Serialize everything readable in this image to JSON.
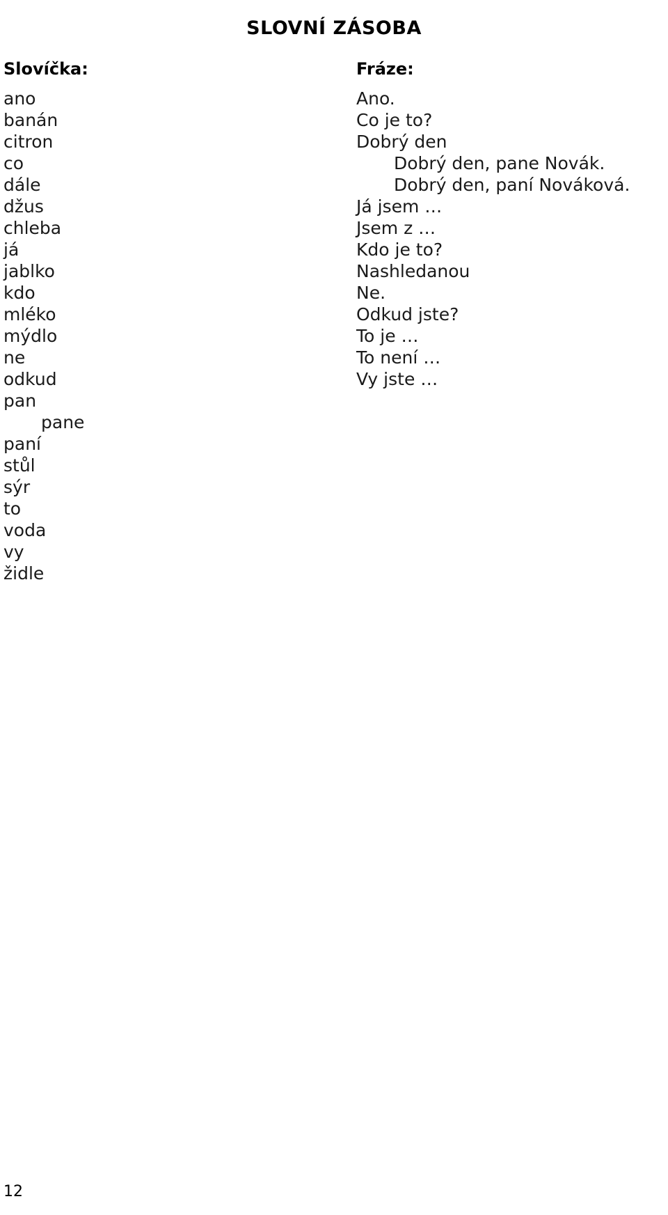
{
  "document": {
    "title": "SLOVNÍ ZÁSOBA",
    "page_number": "12"
  },
  "columns": {
    "vocabulary": {
      "heading": "Slovíčka:",
      "entries": [
        {
          "text": "ano",
          "indent": false
        },
        {
          "text": "banán",
          "indent": false
        },
        {
          "text": "citron",
          "indent": false
        },
        {
          "text": "co",
          "indent": false
        },
        {
          "text": "dále",
          "indent": false
        },
        {
          "text": "džus",
          "indent": false
        },
        {
          "text": "chleba",
          "indent": false
        },
        {
          "text": "já",
          "indent": false
        },
        {
          "text": "jablko",
          "indent": false
        },
        {
          "text": "kdo",
          "indent": false
        },
        {
          "text": "mléko",
          "indent": false
        },
        {
          "text": "mýdlo",
          "indent": false
        },
        {
          "text": "ne",
          "indent": false
        },
        {
          "text": "odkud",
          "indent": false
        },
        {
          "text": "pan",
          "indent": false
        },
        {
          "text": "pane",
          "indent": true
        },
        {
          "text": "paní",
          "indent": false
        },
        {
          "text": "stůl",
          "indent": false
        },
        {
          "text": "sýr",
          "indent": false
        },
        {
          "text": "to",
          "indent": false
        },
        {
          "text": "voda",
          "indent": false
        },
        {
          "text": "vy",
          "indent": false
        },
        {
          "text": "židle",
          "indent": false
        }
      ]
    },
    "phrases": {
      "heading": "Fráze:",
      "entries": [
        {
          "text": "Ano.",
          "indent": false
        },
        {
          "text": "Co je to?",
          "indent": false
        },
        {
          "text": "Dobrý den",
          "indent": false
        },
        {
          "text": "Dobrý den, pane Novák.",
          "indent": true
        },
        {
          "text": "Dobrý den, paní Nováková.",
          "indent": true
        },
        {
          "text": "Já jsem …",
          "indent": false
        },
        {
          "text": "Jsem z …",
          "indent": false
        },
        {
          "text": "Kdo je to?",
          "indent": false
        },
        {
          "text": "Nashledanou",
          "indent": false
        },
        {
          "text": "Ne.",
          "indent": false
        },
        {
          "text": "Odkud jste?",
          "indent": false
        },
        {
          "text": "To je …",
          "indent": false
        },
        {
          "text": "To není …",
          "indent": false
        },
        {
          "text": "Vy jste …",
          "indent": false
        }
      ]
    }
  }
}
